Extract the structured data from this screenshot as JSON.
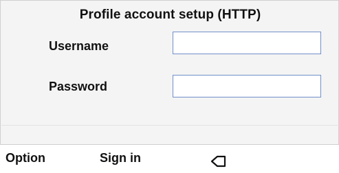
{
  "screen": {
    "title": "Profile account setup (HTTP)"
  },
  "form": {
    "username_label": "Username",
    "username_value": "",
    "password_label": "Password",
    "password_value": ""
  },
  "softkeys": {
    "option_label": "Option",
    "signin_label": "Sign in",
    "back_icon": "backspace-icon"
  },
  "colors": {
    "input_border": "#6f8fc9",
    "panel_background": "#f4f4f4",
    "text": "#111111"
  }
}
